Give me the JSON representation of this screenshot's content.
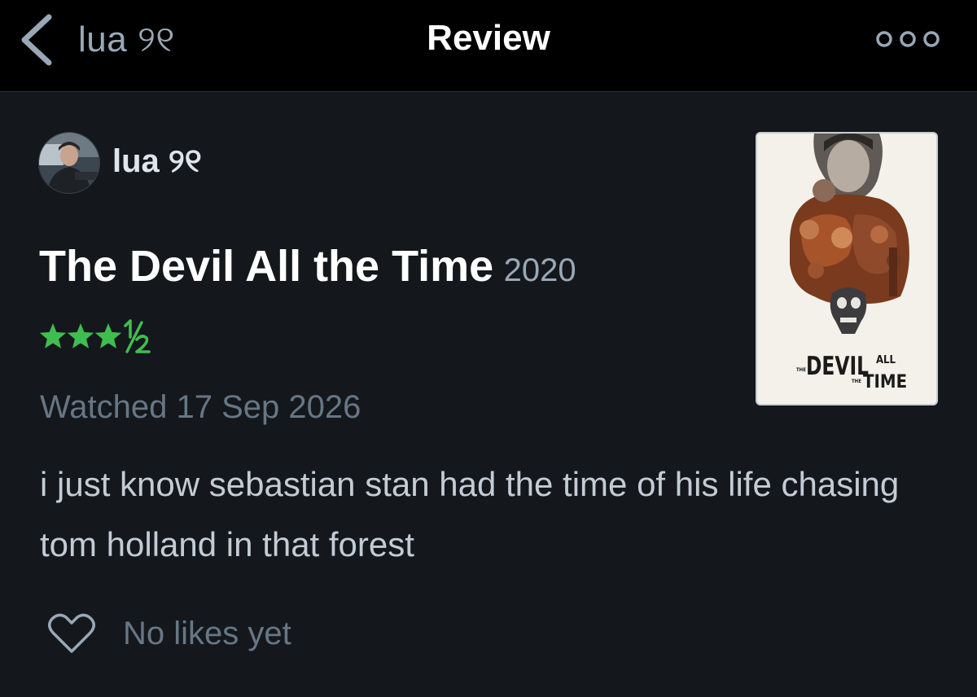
{
  "nav": {
    "back_label": "lua ୨୧",
    "title": "Review"
  },
  "review": {
    "username": "lua ୨୧",
    "film_title": "The Devil All the Time",
    "film_year": "2020",
    "rating": 3.5,
    "rating_max": 5,
    "rating_color": "#40bd4f",
    "watched": "Watched 17 Sep 2026",
    "text": "i just know sebastian stan had the time of his life chasing tom holland in that forest",
    "likes": "No likes yet"
  },
  "poster": {
    "line_the": "THE",
    "line_devil": "DEVIL",
    "line_all": "ALL",
    "line_the2": "THE",
    "line_time": "TIME"
  },
  "colors": {
    "background": "#14181c",
    "topbar": "#000000",
    "text_primary": "#ffffff",
    "text_secondary": "#9aa8b6",
    "text_muted": "#677685",
    "star_green": "#40bd4f"
  }
}
